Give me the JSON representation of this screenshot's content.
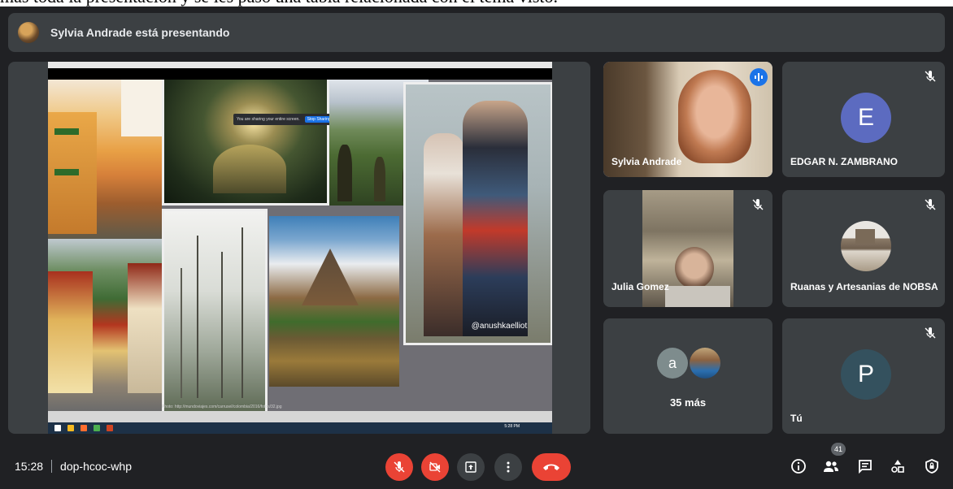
{
  "caption": "más toda la presentación y se les pasó una tabla relacionada con el tema visto.",
  "banner": {
    "presenter_text": "Sylvia Andrade está presentando"
  },
  "shared_screen": {
    "share_notice": "You are sharing your entire screen.",
    "stop_label": "Stop Sharing",
    "photo_handle": "@anushkaelliot",
    "source_link": "Photo: http://mundoviajes.com/carrusel/colombia/2016/fotos/32.jpg",
    "clock": "5:28 PM"
  },
  "participants": [
    {
      "name": "Sylvia Andrade",
      "speaking": true
    },
    {
      "name": "EDGAR N. ZAMBRANO",
      "initial": "E",
      "avatar_color": "#5c6bc0",
      "muted": true
    },
    {
      "name": "Julia Gomez",
      "muted": true
    },
    {
      "name": "Ruanas y Artesanias de NOBSA",
      "muted": true
    },
    {
      "more_label": "35 más",
      "initial": "a",
      "avatar_color": "#7e8c8d"
    },
    {
      "name": "Tú",
      "initial": "P",
      "avatar_color": "#34515e",
      "muted": true
    }
  ],
  "controls": {
    "time": "15:28",
    "meeting_code": "dop-hcoc-whp",
    "people_count": "41"
  },
  "colors": {
    "accent_red": "#ea4335",
    "speaking_blue": "#8ab4f8",
    "tile_bg": "#3c4043",
    "bg": "#202124"
  },
  "icons": [
    "mic-off-icon",
    "camera-off-icon",
    "present-icon",
    "more-options-icon",
    "hang-up-icon",
    "info-icon",
    "people-icon",
    "chat-icon",
    "activities-icon",
    "host-controls-icon"
  ]
}
